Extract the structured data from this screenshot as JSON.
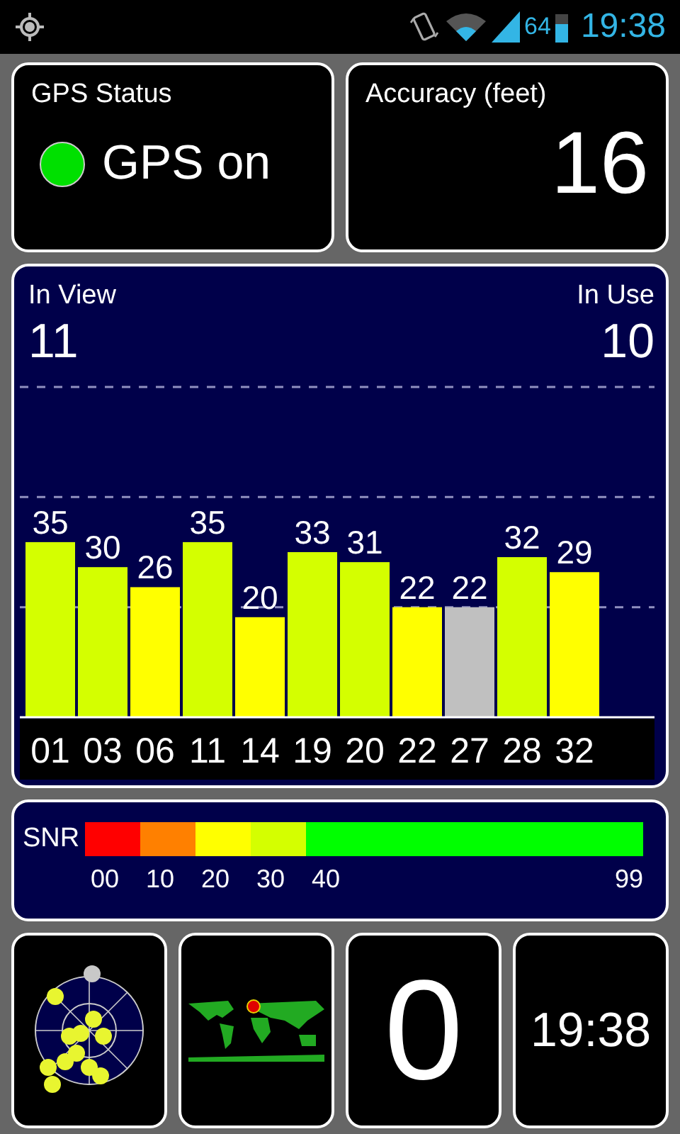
{
  "status_bar": {
    "battery": "64",
    "time": "19:38"
  },
  "gps_status": {
    "title": "GPS Status",
    "on": true,
    "text": "GPS on"
  },
  "accuracy": {
    "title": "Accuracy (feet)",
    "value": "16"
  },
  "satellites": {
    "in_view_label": "In View",
    "in_view": "11",
    "in_use_label": "In Use",
    "in_use": "10",
    "bars": [
      {
        "in_use": true
      },
      {
        "in_use": true
      },
      {
        "in_use": true
      },
      {
        "in_use": true
      },
      {
        "in_use": true
      },
      {
        "in_use": true
      },
      {
        "in_use": true
      },
      {
        "in_use": true
      },
      {
        "in_use": false
      },
      {
        "in_use": true
      },
      {
        "in_use": true
      }
    ],
    "chart_data": {
      "type": "bar",
      "categories": [
        "01",
        "03",
        "06",
        "11",
        "14",
        "19",
        "20",
        "22",
        "27",
        "28",
        "32"
      ],
      "values": [
        35,
        30,
        26,
        35,
        20,
        33,
        31,
        22,
        22,
        32,
        29
      ],
      "data_labels": true
    }
  },
  "snr_scale": {
    "label": "SNR",
    "segments": [
      {
        "label": "00",
        "color": "#ff0000"
      },
      {
        "label": "10",
        "color": "#ff8000"
      },
      {
        "label": "20",
        "color": "#ffff00"
      },
      {
        "label": "30",
        "color": "#d4ff00"
      },
      {
        "label": "40",
        "color": "#00ff00"
      }
    ],
    "end_label": "99"
  },
  "bottom": {
    "satellite_count": "0",
    "time": "19:38"
  }
}
